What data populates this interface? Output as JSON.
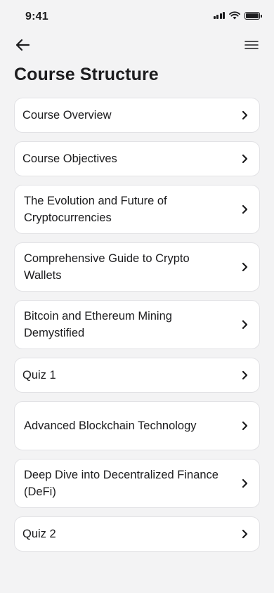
{
  "status_bar": {
    "time": "9:41",
    "icons": [
      "signal-icon",
      "wifi-icon",
      "battery-icon"
    ]
  },
  "nav": {
    "back_icon": "arrow-left-icon",
    "menu_icon": "hamburger-menu-icon"
  },
  "page": {
    "title": "Course Structure"
  },
  "course_items": [
    {
      "label": "Course Overview"
    },
    {
      "label": "Course Objectives"
    },
    {
      "label": "The Evolution and Future of Cryptocurrencies"
    },
    {
      "label": "Comprehensive Guide to Crypto Wallets"
    },
    {
      "label": "Bitcoin and Ethereum Mining Demystified"
    },
    {
      "label": "Quiz 1"
    },
    {
      "label": "Advanced Blockchain Technology"
    },
    {
      "label": "Deep Dive into Decentralized Finance (DeFi)"
    },
    {
      "label": "Quiz 2"
    }
  ],
  "colors": {
    "background": "#f3f3f4",
    "card": "#ffffff",
    "card_border": "#e2e2e5",
    "text": "#1c1c1e"
  }
}
